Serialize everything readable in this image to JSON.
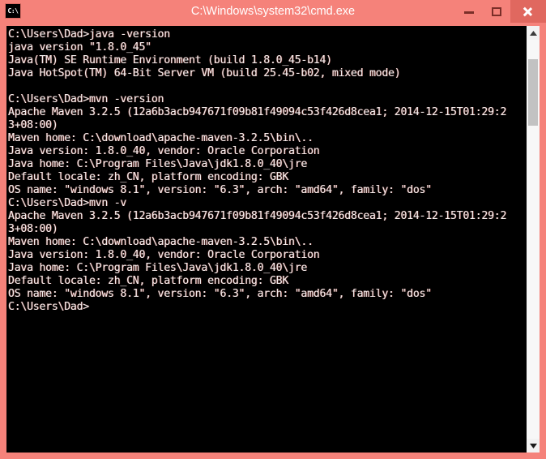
{
  "window": {
    "title": "C:\\Windows\\system32\\cmd.exe",
    "icon_label": "C:\\",
    "icon_name": "cmd-console-icon",
    "titlebar_color": "#f5827a",
    "close_button_color": "#e0685f",
    "console_background": "#000000",
    "console_text_color": "#f2efef",
    "controls": {
      "minimize_label": "Minimize",
      "maximize_label": "Maximize",
      "close_label": "Close"
    }
  },
  "scrollbar": {
    "up_arrow_label": "Scroll up",
    "down_arrow_label": "Scroll down",
    "thumb_label": "Scroll thumb"
  },
  "console": {
    "lines": [
      "C:\\Users\\Dad>java -version",
      "java version \"1.8.0_45\"",
      "Java(TM) SE Runtime Environment (build 1.8.0_45-b14)",
      "Java HotSpot(TM) 64-Bit Server VM (build 25.45-b02, mixed mode)",
      "",
      "C:\\Users\\Dad>mvn -version",
      "Apache Maven 3.2.5 (12a6b3acb947671f09b81f49094c53f426d8cea1; 2014-12-15T01:29:2",
      "3+08:00)",
      "Maven home: C:\\download\\apache-maven-3.2.5\\bin\\..",
      "Java version: 1.8.0_40, vendor: Oracle Corporation",
      "Java home: C:\\Program Files\\Java\\jdk1.8.0_40\\jre",
      "Default locale: zh_CN, platform encoding: GBK",
      "OS name: \"windows 8.1\", version: \"6.3\", arch: \"amd64\", family: \"dos\"",
      "C:\\Users\\Dad>mvn -v",
      "Apache Maven 3.2.5 (12a6b3acb947671f09b81f49094c53f426d8cea1; 2014-12-15T01:29:2",
      "3+08:00)",
      "Maven home: C:\\download\\apache-maven-3.2.5\\bin\\..",
      "Java version: 1.8.0_40, vendor: Oracle Corporation",
      "Java home: C:\\Program Files\\Java\\jdk1.8.0_40\\jre",
      "Default locale: zh_CN, platform encoding: GBK",
      "OS name: \"windows 8.1\", version: \"6.3\", arch: \"amd64\", family: \"dos\"",
      "C:\\Users\\Dad>"
    ]
  }
}
